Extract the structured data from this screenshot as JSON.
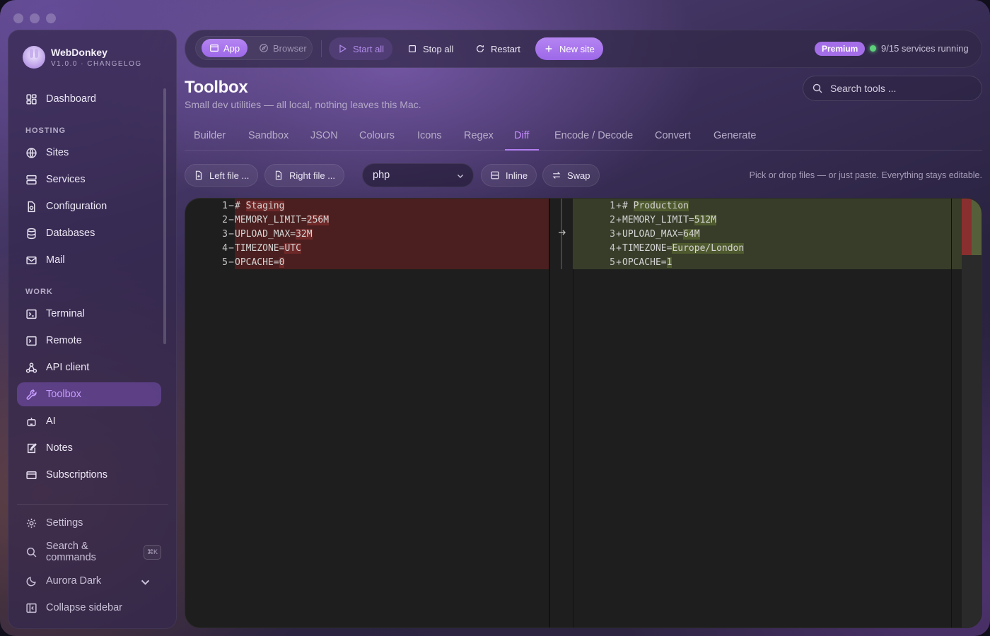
{
  "app": {
    "name": "WebDonkey",
    "version_line": "V1.0.0 · CHANGELOG"
  },
  "sidebar": {
    "dashboard": "Dashboard",
    "section_hosting": "HOSTING",
    "hosting": [
      "Sites",
      "Services",
      "Configuration",
      "Databases",
      "Mail"
    ],
    "section_work": "WORK",
    "work": [
      "Terminal",
      "Remote",
      "API client",
      "Toolbox",
      "AI",
      "Notes",
      "Subscriptions"
    ],
    "active_item": "Toolbox",
    "settings": "Settings",
    "search_commands": "Search & commands",
    "search_shortcut": "⌘K",
    "theme": "Aurora Dark",
    "collapse": "Collapse sidebar"
  },
  "toolbar": {
    "mode_app": "App",
    "mode_browser": "Browser",
    "start_all": "Start all",
    "stop_all": "Stop all",
    "restart": "Restart",
    "new_site": "New site",
    "premium": "Premium",
    "services_status": "9/15 services running"
  },
  "header": {
    "title": "Toolbox",
    "subtitle": "Small dev utilities — all local, nothing leaves this Mac.",
    "search_placeholder": "Search tools ..."
  },
  "tabs": [
    "Builder",
    "Sandbox",
    "JSON",
    "Colours",
    "Icons",
    "Regex",
    "Diff",
    "Encode / Decode",
    "Convert",
    "Generate"
  ],
  "active_tab": "Diff",
  "diff": {
    "left_file": "Left file ...",
    "right_file": "Right file ...",
    "language": "php",
    "inline": "Inline",
    "swap": "Swap",
    "hint": "Pick or drop files — or just paste. Everything stays editable.",
    "left_lines": [
      {
        "n": "1",
        "m": "−",
        "pre": "# ",
        "chg": "Staging",
        "post": "",
        "comment": true
      },
      {
        "n": "2",
        "m": "−",
        "pre": "MEMORY_LIMIT=",
        "chg": "256M",
        "post": ""
      },
      {
        "n": "3",
        "m": "−",
        "pre": "UPLOAD_MAX=",
        "chg": "32M",
        "post": ""
      },
      {
        "n": "4",
        "m": "−",
        "pre": "TIMEZONE=",
        "chg": "UTC",
        "post": ""
      },
      {
        "n": "5",
        "m": "−",
        "pre": "OPCACHE=",
        "chg": "0",
        "post": ""
      }
    ],
    "right_lines": [
      {
        "n": "1",
        "m": "+",
        "pre": "# ",
        "chg": "Production",
        "post": "",
        "comment": true
      },
      {
        "n": "2",
        "m": "+",
        "pre": "MEMORY_LIMIT=",
        "chg": "512M",
        "post": ""
      },
      {
        "n": "3",
        "m": "+",
        "pre": "UPLOAD_MAX=",
        "chg": "64M",
        "post": ""
      },
      {
        "n": "4",
        "m": "+",
        "pre": "TIMEZONE=",
        "chg": "Europe/London",
        "post": ""
      },
      {
        "n": "5",
        "m": "+",
        "pre": "OPCACHE=",
        "chg": "1",
        "post": ""
      }
    ]
  },
  "colors": {
    "accent": "#a46ee8",
    "removed_line": "#4b1f1f",
    "added_line": "#373d29",
    "status_ok": "#5cd07a"
  }
}
